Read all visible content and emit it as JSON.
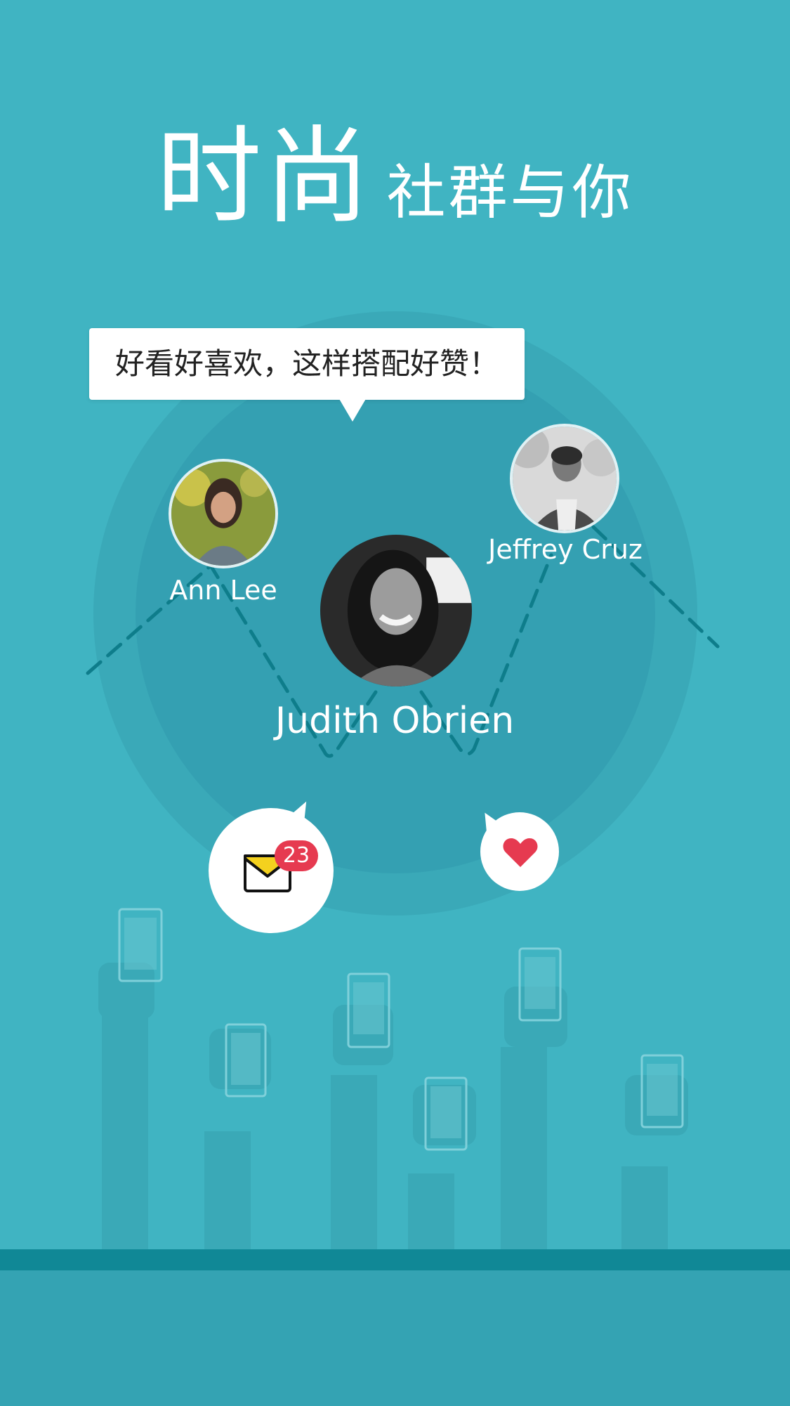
{
  "headline": {
    "main": "时尚",
    "sub": "社群与你"
  },
  "comment": {
    "text": "好看好喜欢，这样搭配好赞！"
  },
  "users": [
    {
      "name": "Ann Lee"
    },
    {
      "name": "Jeffrey Cruz"
    },
    {
      "name": "Judith Obrien"
    }
  ],
  "actions": {
    "messages_badge": "23",
    "message_icon": "mail-icon",
    "like_icon": "heart-icon"
  },
  "colors": {
    "background": "#40b4c2",
    "badge": "#e63a50",
    "heart": "#e63a50",
    "mail_yellow": "#f4d11e",
    "floor": "#108896"
  }
}
